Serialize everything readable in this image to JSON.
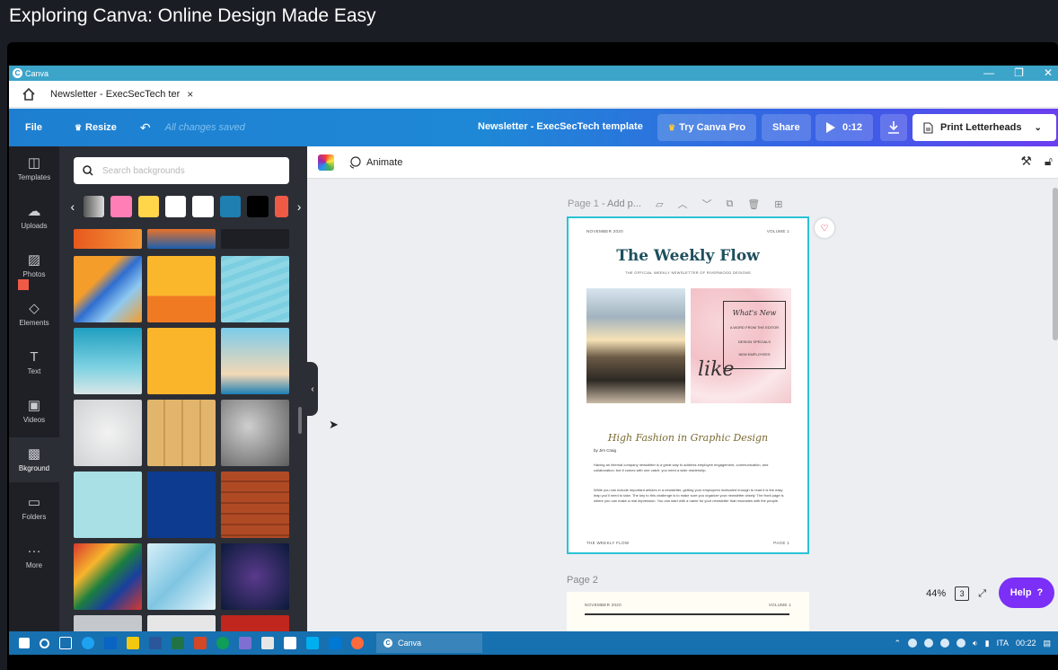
{
  "video": {
    "title": "Exploring Canva: Online Design Made Easy"
  },
  "window": {
    "app_name": "Canva",
    "controls": [
      "—",
      "❐",
      "✕"
    ]
  },
  "tabbar": {
    "tab_title": "Newsletter - ExecSecTech ter",
    "close": "×"
  },
  "toolbar": {
    "file": "File",
    "resize": "Resize",
    "saved_status": "All changes saved",
    "doc_title": "Newsletter - ExecSecTech template",
    "try_pro": "Try Canva Pro",
    "share": "Share",
    "play_time": "0:12",
    "print": "Print Letterheads"
  },
  "rail": [
    {
      "label": "Templates",
      "icon": "templates-icon"
    },
    {
      "label": "Uploads",
      "icon": "uploads-icon"
    },
    {
      "label": "Photos",
      "icon": "photos-icon"
    },
    {
      "label": "Elements",
      "icon": "elements-icon"
    },
    {
      "label": "Text",
      "icon": "text-icon"
    },
    {
      "label": "Videos",
      "icon": "videos-icon"
    },
    {
      "label": "Bkground",
      "icon": "background-icon"
    },
    {
      "label": "Folders",
      "icon": "folders-icon"
    },
    {
      "label": "More",
      "icon": "more-icon"
    }
  ],
  "panel": {
    "search_placeholder": "Search backgrounds",
    "swatches": [
      "#ff7eb6",
      "#ffd54a",
      "#ffffff",
      "#ffffff",
      "#1e7fb0",
      "#000000"
    ]
  },
  "canvas": {
    "animate": "Animate",
    "page1_label": "Page 1",
    "page1_add": "- Add p...",
    "page2_label": "Page 2",
    "zoom": "44%",
    "page_count": "3",
    "help": "Help",
    "help_mark": "?"
  },
  "newsletter": {
    "date": "NOVEMBER 2020",
    "volume": "VOLUME 1",
    "title": "The Weekly Flow",
    "subtitle": "THE OFFICIAL WEEKLY NEWSLETTER OF RIVERWOOD DESIGNS",
    "whats_new": "What's New",
    "items": [
      "A WORD FROM THE EDITOR",
      "DESIGN SPECIALS",
      "NEW EMPLOYEES"
    ],
    "like": "like",
    "heading": "High Fashion in Graphic Design",
    "byline": "by Jim Craig",
    "para1": "Having an internal company newsletter is a great way to address employee engagement, communication, and collaboration, but it comes with one catch: you need a wide readership.",
    "para2": "While you can include important articles in a newsletter, getting your employees motivated enough to read it is the easy leap you'll need to take. The key to this challenge is to make sure you organize your newsletter wisely. The front page is where you can make a real impression. You can start with a name for your newsletter that resonates with the people.",
    "footer_left": "THE WEEKLY FLOW",
    "footer_right": "PAGE 1"
  },
  "taskbar": {
    "canva_label": "Canva",
    "lang": "ITA",
    "time": "00:22"
  },
  "colors": {
    "canva_blue": "#1e88d6",
    "help_purple": "#7b2ff7",
    "selection": "#2ac3d6"
  }
}
